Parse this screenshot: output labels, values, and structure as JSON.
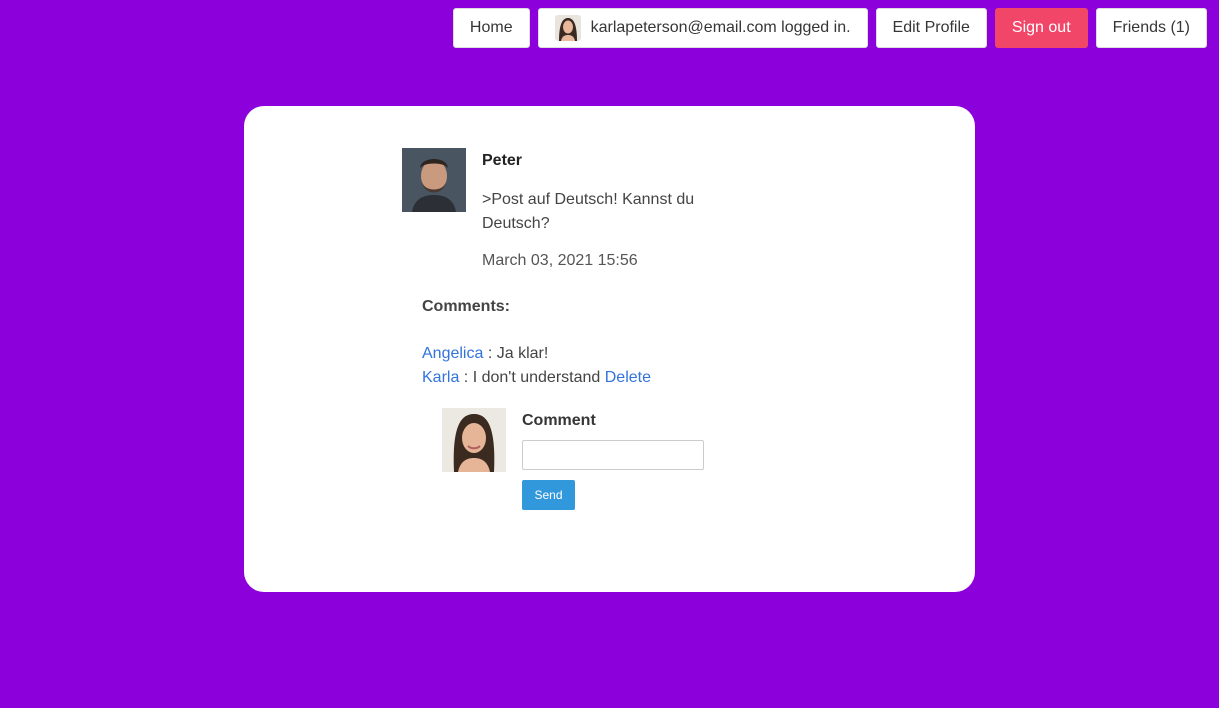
{
  "nav": {
    "home": "Home",
    "user_status": "karlapeterson@email.com logged in.",
    "edit_profile": "Edit Profile",
    "sign_out": "Sign out",
    "friends": "Friends (1)"
  },
  "colors": {
    "background": "#8c00dc",
    "danger": "#f14668",
    "link": "#3273dc",
    "primary_button": "#3298dc"
  },
  "post": {
    "author": "Peter",
    "text": ">Post auf Deutsch! Kannst du Deutsch?",
    "date": "March 03, 2021 15:56"
  },
  "comments": {
    "heading": "Comments:",
    "items": [
      {
        "author": "Angelica",
        "separator": " : ",
        "text": "Ja klar!"
      },
      {
        "author": "Karla",
        "separator": " : ",
        "text": "I don't understand ",
        "action": "Delete"
      }
    ]
  },
  "new_comment": {
    "label": "Comment",
    "value": "",
    "send_label": "Send"
  }
}
